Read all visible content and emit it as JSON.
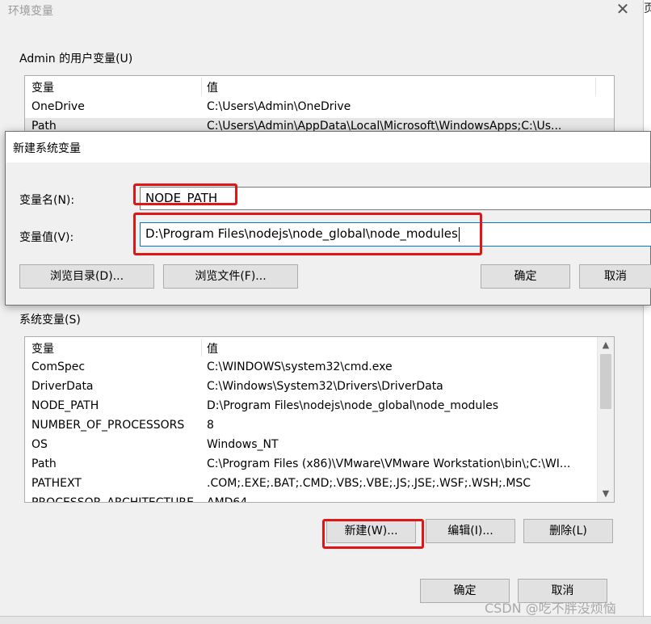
{
  "window": {
    "title": "环境变量",
    "close_glyph": "✕"
  },
  "background": {
    "right_edge_text": "页"
  },
  "user_vars": {
    "group_label": "Admin 的用户变量(U)",
    "headers": [
      "变量",
      "值"
    ],
    "rows": [
      {
        "name": "OneDrive",
        "value": "C:\\Users\\Admin\\OneDrive"
      },
      {
        "name": "Path",
        "value": "C:\\Users\\Admin\\AppData\\Local\\Microsoft\\WindowsApps;C:\\Us..."
      }
    ]
  },
  "new_var_dialog": {
    "title": "新建系统变量",
    "name_label": "变量名(N):",
    "name_value": "NODE_PATH",
    "value_label": "变量值(V):",
    "value_value": "D:\\Program Files\\nodejs\\node_global\\node_modules",
    "browse_dir_button": "浏览目录(D)...",
    "browse_file_button": "浏览文件(F)...",
    "ok_button": "确定",
    "cancel_button": "取消"
  },
  "system_vars": {
    "group_label": "系统变量(S)",
    "headers": [
      "变量",
      "值"
    ],
    "rows": [
      {
        "name": "ComSpec",
        "value": "C:\\WINDOWS\\system32\\cmd.exe"
      },
      {
        "name": "DriverData",
        "value": "C:\\Windows\\System32\\Drivers\\DriverData"
      },
      {
        "name": "NODE_PATH",
        "value": "D:\\Program Files\\nodejs\\node_global\\node_modules"
      },
      {
        "name": "NUMBER_OF_PROCESSORS",
        "value": "8"
      },
      {
        "name": "OS",
        "value": "Windows_NT"
      },
      {
        "name": "Path",
        "value": "C:\\Program Files (x86)\\VMware\\VMware Workstation\\bin\\;C:\\WI..."
      },
      {
        "name": "PATHEXT",
        "value": ".COM;.EXE;.BAT;.CMD;.VBS;.VBE;.JS;.JSE;.WSF;.WSH;.MSC"
      },
      {
        "name": "PROCESSOR_ARCHITECTURE",
        "value": "AMD64"
      }
    ],
    "new_button": "新建(W)...",
    "edit_button": "编辑(I)...",
    "delete_button": "删除(L)"
  },
  "footer": {
    "ok_button": "确定",
    "cancel_button": "取消"
  },
  "watermark": "CSDN @吃不胖没烦恼",
  "colors": {
    "highlight_red": "#e01515",
    "focus_blue": "#0078d7",
    "selected_row": "#e5e5e5"
  }
}
